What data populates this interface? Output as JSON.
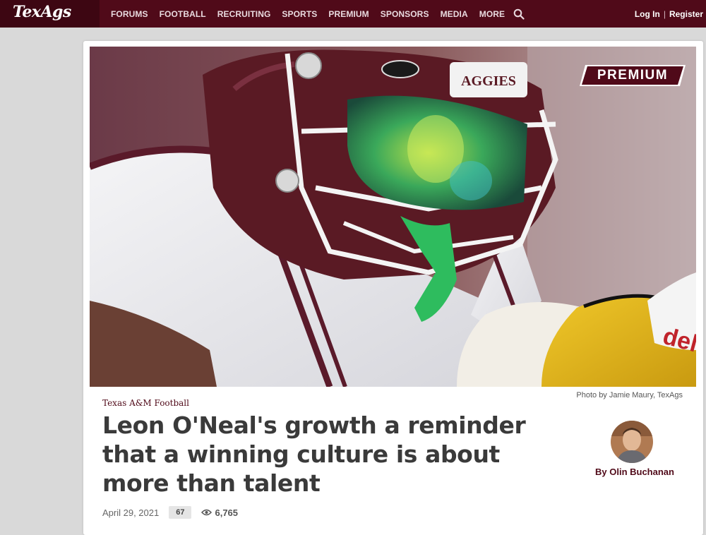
{
  "site": {
    "logo": "TexAgs",
    "brand_color": "#500a19"
  },
  "nav": {
    "items": [
      "FORUMS",
      "FOOTBALL",
      "RECRUITING",
      "SPORTS",
      "PREMIUM",
      "SPONSORS",
      "MEDIA",
      "MORE"
    ],
    "search_icon": "search-icon",
    "login": "Log In",
    "separator": "|",
    "register": "Register"
  },
  "article": {
    "badge": "PREMIUM",
    "helmet_text": "AGGIES",
    "glove_text": "dell",
    "photo_credit": "Photo by Jamie Maury, TexAgs",
    "section": "Texas A&M Football",
    "headline": "Leon O'Neal's growth a reminder that a winning culture is about more than talent",
    "author": "By Olin Buchanan",
    "date": "April 29, 2021",
    "comments": "67",
    "views": "6,765"
  }
}
